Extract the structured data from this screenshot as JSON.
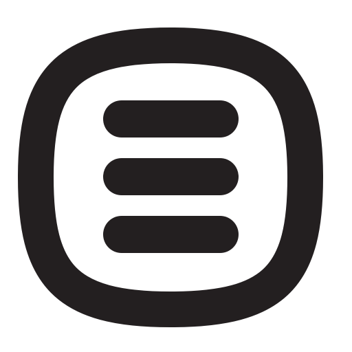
{
  "app": {
    "name": "",
    "accessible_label": ""
  },
  "icon": {
    "semantic_name": "menu-icon",
    "style": "hamburger menu inside rounded squircle outline",
    "line_count": 3,
    "colors": {
      "foreground": "#231f20",
      "background": "#ffffff"
    }
  }
}
